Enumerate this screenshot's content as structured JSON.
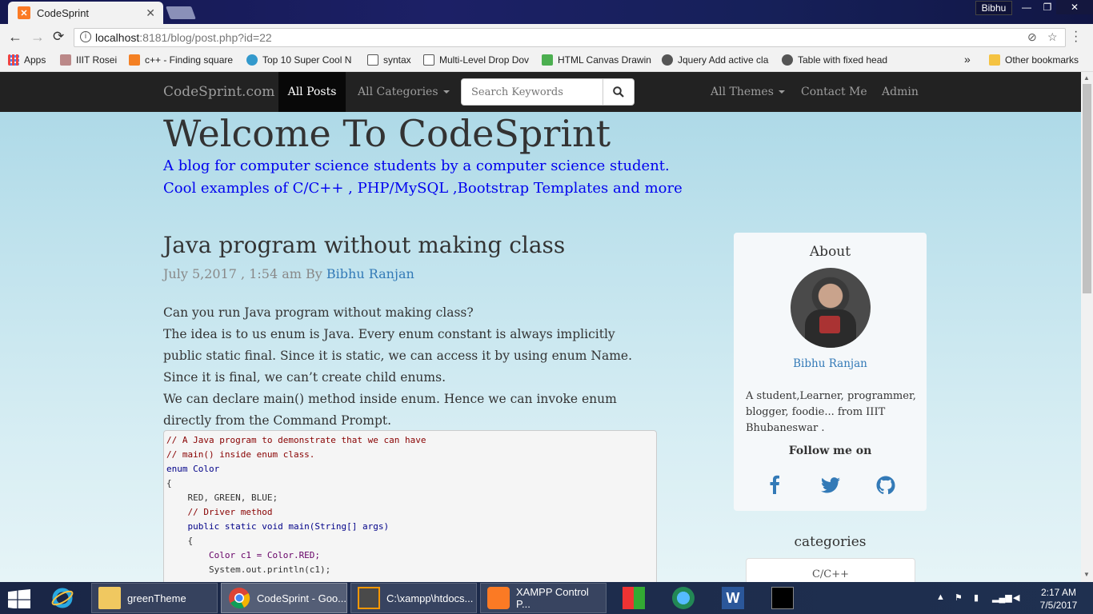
{
  "browser": {
    "tab_title": "CodeSprint",
    "tab_favicon": "xampp-icon",
    "user": "Bibhu",
    "url_host": "localhost",
    "url_rest": ":8181/blog/post.php?id=22",
    "bookmarks": [
      {
        "label": "Apps",
        "icon": "apps-grid-icon"
      },
      {
        "label": "IIIT Rosei",
        "icon": "site-icon"
      },
      {
        "label": "c++ - Finding square",
        "icon": "stackoverflow-icon"
      },
      {
        "label": "Top 10 Super Cool N",
        "icon": "site-icon"
      },
      {
        "label": "syntax",
        "icon": "page-icon"
      },
      {
        "label": "Multi-Level Drop Dov",
        "icon": "page-icon"
      },
      {
        "label": "HTML Canvas Drawin",
        "icon": "w3schools-icon"
      },
      {
        "label": "Jquery Add active cla",
        "icon": "github-icon"
      },
      {
        "label": "Table with fixed head",
        "icon": "github-icon"
      }
    ],
    "bookmarks_more": "»",
    "other_bookmarks": "Other bookmarks"
  },
  "site": {
    "brand": "CodeSprint.com",
    "nav_all_posts": "All Posts",
    "nav_categories": "All Categories",
    "search_placeholder": "Search Keywords",
    "nav_themes": "All Themes",
    "nav_contact": "Contact Me",
    "nav_admin": "Admin"
  },
  "hero": {
    "title": "Welcome To CodeSprint",
    "tagline_1": "A blog for computer science students by a computer science student.",
    "tagline_2": "Cool examples of C/C++ , PHP/MySQL ,Bootstrap Templates and more"
  },
  "post": {
    "title": "Java program without making class",
    "date": "July 5,2017 , 1:54 am By ",
    "author": "Bibhu Ranjan",
    "paragraphs": [
      "Can you run Java program without making class?",
      "The idea is to us enum is Java. Every enum constant is always implicitly public static final. Since it is static, we can access it by using enum Name. Since it is final, we can’t create child enums.",
      "We can declare main() method inside enum. Hence we can invoke enum directly from the Command Prompt."
    ],
    "code_lines": [
      "// A Java program to demonstrate that we can have",
      "// main() inside enum class.",
      "enum Color",
      "{",
      "    RED, GREEN, BLUE;",
      "",
      "    // Driver method",
      "    public static void main(String[] args)",
      "    {",
      "        Color c1 = Color.RED;",
      "        System.out.println(c1);"
    ]
  },
  "sidebar": {
    "about_title": "About",
    "name": "Bibhu Ranjan",
    "bio": "A student,Learner, programmer, blogger, foodie... from IIIT Bhubaneswar .",
    "follow": "Follow me on",
    "social": [
      "facebook-icon",
      "twitter-icon",
      "github-icon"
    ],
    "categories_title": "categories",
    "categories": [
      "C/C++"
    ]
  },
  "taskbar": {
    "items": [
      {
        "label": "",
        "icon": "internet-explorer-icon"
      },
      {
        "label": "greenTheme",
        "icon": "folder-icon"
      },
      {
        "label": "CodeSprint - Goo...",
        "icon": "chrome-icon"
      },
      {
        "label": "C:\\xampp\\htdocs...",
        "icon": "sublime-icon"
      },
      {
        "label": "XAMPP Control P...",
        "icon": "xampp-icon"
      }
    ],
    "time": "2:17 AM",
    "date": "7/5/2017"
  },
  "colors": {
    "navbar": "#222222",
    "link": "#337ab7",
    "tagline": "#0000ee"
  }
}
